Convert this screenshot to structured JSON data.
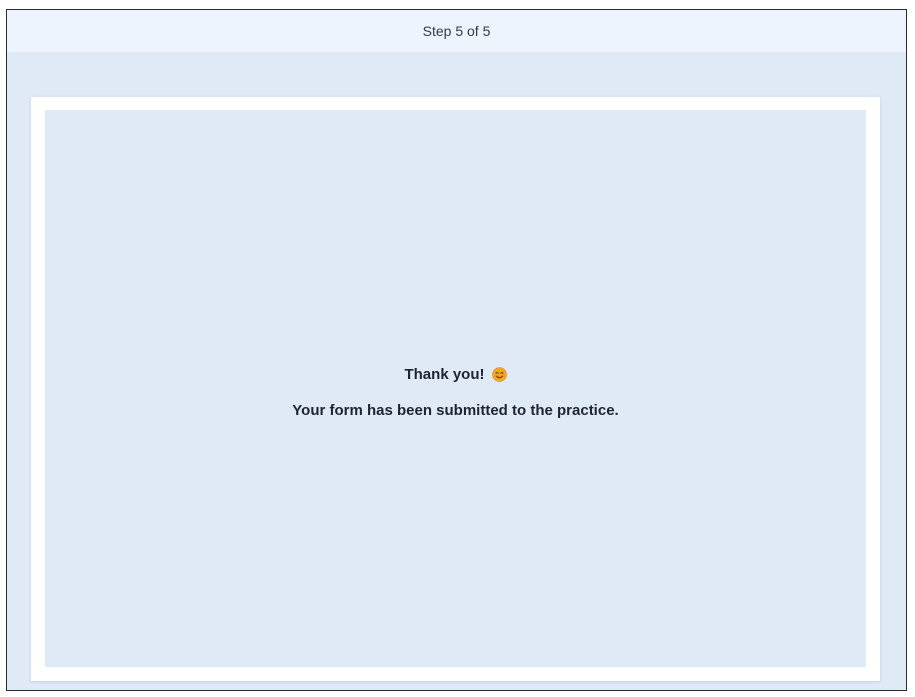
{
  "header": {
    "step_text": "Step 5 of 5"
  },
  "confirmation": {
    "title": "Thank you!",
    "icon": "smiling-face-icon",
    "message": "Your form has been submitted to the practice."
  },
  "colors": {
    "page_background": "#e0eaf6",
    "header_background": "#eef4fe",
    "card_background": "#ffffff",
    "text": "#1f2530",
    "emoji_fill": "#f5a623"
  }
}
